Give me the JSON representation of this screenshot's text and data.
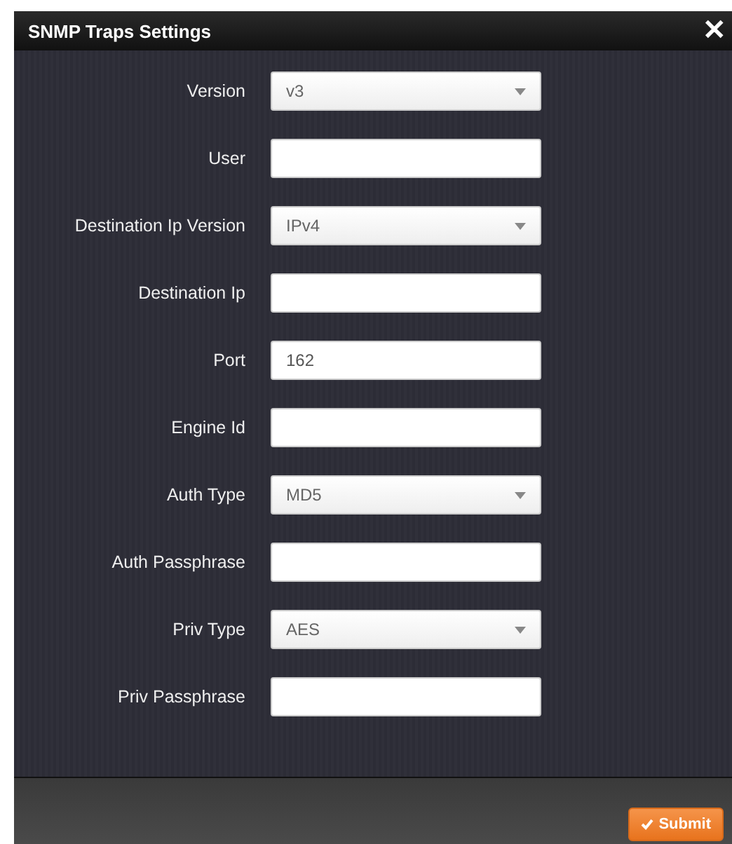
{
  "dialog": {
    "title": "SNMP Traps Settings",
    "close": "✕"
  },
  "fields": [
    {
      "label": "Version",
      "kind": "select",
      "value": "v3"
    },
    {
      "label": "User",
      "kind": "text"
    },
    {
      "label": "Destination Ip Version",
      "kind": "select",
      "value": "IPv4"
    },
    {
      "label": "Destination Ip",
      "kind": "text"
    },
    {
      "label": "Port",
      "kind": "text",
      "value": "162"
    },
    {
      "label": "Engine Id",
      "kind": "text"
    },
    {
      "label": "Auth Type",
      "kind": "select",
      "value": "MD5"
    },
    {
      "label": "Auth Passphrase",
      "kind": "text"
    },
    {
      "label": "Priv Type",
      "kind": "select",
      "value": "AES"
    },
    {
      "label": "Priv Passphrase",
      "kind": "text"
    }
  ],
  "submit": {
    "label": "Submit"
  }
}
